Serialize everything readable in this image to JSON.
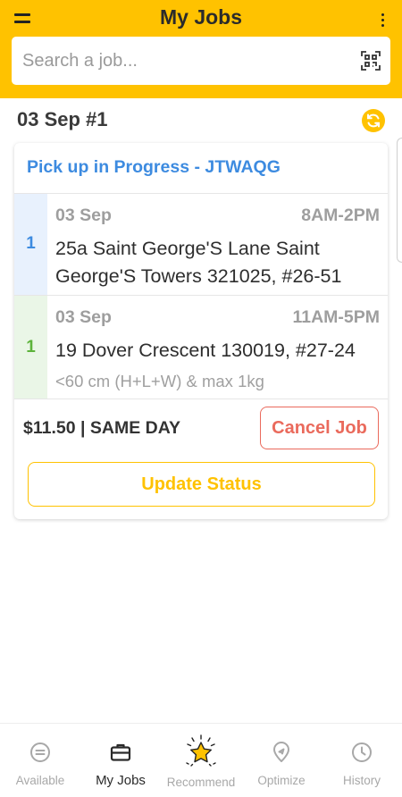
{
  "header": {
    "title": "My Jobs",
    "search_placeholder": "Search a job..."
  },
  "section": {
    "date_heading": "03 Sep #1"
  },
  "job_card": {
    "title": "Pick up in Progress - JTWAQG",
    "stops": [
      {
        "number": "1",
        "date": "03 Sep",
        "time": "8AM-2PM",
        "address_line1": "25a Saint George'S Lane Saint",
        "address_line2": "George'S Towers 321025, #26-51",
        "band_color": "#E8F1FD",
        "number_color": "#3D8BE0"
      },
      {
        "number": "1",
        "date": "03 Sep",
        "time": "11AM-5PM",
        "address_line1": "19 Dover Crescent 130019, #27-24",
        "note": "<60 cm (H+L+W) & max 1kg",
        "band_color": "#EAF6E7",
        "number_color": "#5DB33C"
      }
    ],
    "price": "$11.50 | SAME DAY",
    "cancel_label": "Cancel Job",
    "update_label": "Update Status"
  },
  "bottom_nav": {
    "items": [
      {
        "label": "Available",
        "icon": "list-circle-icon"
      },
      {
        "label": "My Jobs",
        "icon": "briefcase-icon",
        "active": true
      },
      {
        "label": "Recommend",
        "icon": "star-icon"
      },
      {
        "label": "Optimize",
        "icon": "route-pin-icon"
      },
      {
        "label": "History",
        "icon": "clock-icon"
      }
    ]
  },
  "colors": {
    "brand_yellow": "#FFC200",
    "link_blue": "#3D8BE0",
    "cancel_red": "#EA6A5C",
    "green": "#5DB33C"
  }
}
